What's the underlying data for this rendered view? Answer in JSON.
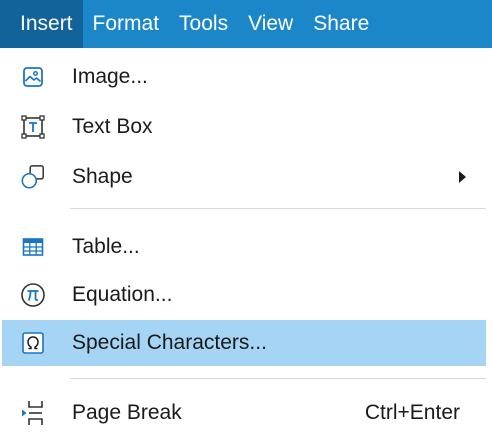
{
  "menubar": {
    "items": [
      {
        "label": "Insert",
        "active": true
      },
      {
        "label": "Format"
      },
      {
        "label": "Tools"
      },
      {
        "label": "View"
      },
      {
        "label": "Share"
      }
    ]
  },
  "dropdown": {
    "items": [
      {
        "label": "Image...",
        "icon": "image-icon"
      },
      {
        "label": "Text Box",
        "icon": "text-box-icon"
      },
      {
        "label": "Shape",
        "icon": "shape-icon",
        "submenu": true
      },
      {
        "label": "Table...",
        "icon": "table-icon"
      },
      {
        "label": "Equation...",
        "icon": "pi-icon"
      },
      {
        "label": "Special Characters...",
        "icon": "omega-icon",
        "highlighted": true
      },
      {
        "label": "Page Break",
        "icon": "page-break-icon",
        "shortcut": "Ctrl+Enter"
      }
    ]
  },
  "colors": {
    "menubar_bg": "#1b87c9",
    "active_tab_bg": "#11639a",
    "highlight_bg": "#a6d4f5",
    "icon_color": "#1976c2"
  }
}
